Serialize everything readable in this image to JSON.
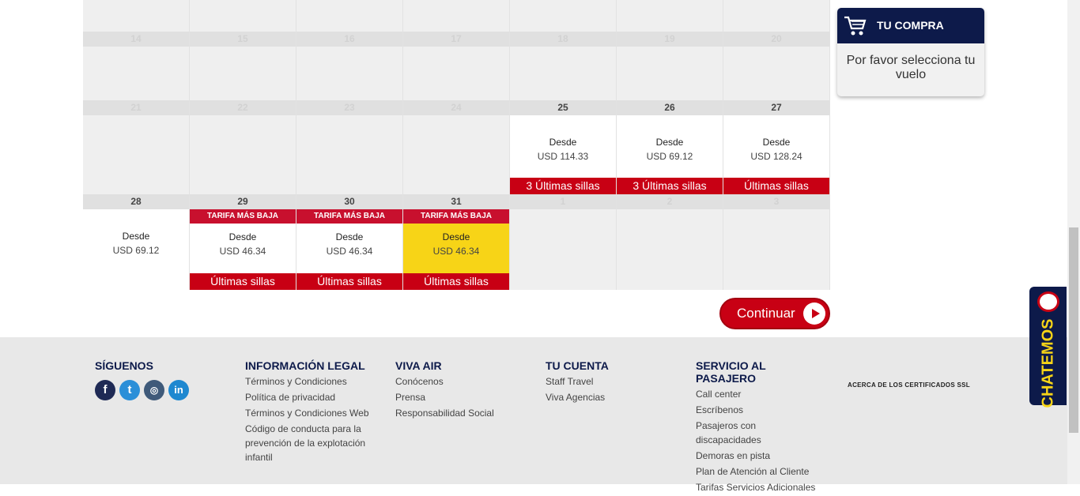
{
  "calendar": {
    "row1": [
      {},
      {},
      {},
      {},
      {},
      {},
      {}
    ],
    "row2": [
      {
        "day": "14"
      },
      {
        "day": "15"
      },
      {
        "day": "16"
      },
      {
        "day": "17"
      },
      {
        "day": "18"
      },
      {
        "day": "19"
      },
      {
        "day": "20"
      }
    ],
    "row3": [
      {
        "day": "21"
      },
      {
        "day": "22"
      },
      {
        "day": "23"
      },
      {
        "day": "24"
      },
      {
        "day": "25",
        "from": "Desde",
        "price": "USD 114.33",
        "seats": "3 Últimas sillas"
      },
      {
        "day": "26",
        "from": "Desde",
        "price": "USD 69.12",
        "seats": "3 Últimas sillas"
      },
      {
        "day": "27",
        "from": "Desde",
        "price": "USD 128.24",
        "seats": "Últimas sillas"
      }
    ],
    "row4": [
      {
        "day": "28",
        "from": "Desde",
        "price": "USD 69.12"
      },
      {
        "day": "29",
        "tag": "TARIFA MÁS BAJA",
        "from": "Desde",
        "price": "USD 46.34",
        "seats": "Últimas sillas"
      },
      {
        "day": "30",
        "tag": "TARIFA MÁS BAJA",
        "from": "Desde",
        "price": "USD 46.34",
        "seats": "Últimas sillas"
      },
      {
        "day": "31",
        "tag": "TARIFA MÁS BAJA",
        "from": "Desde",
        "price": "USD 46.34",
        "seats": "Últimas sillas",
        "selected": true
      },
      {
        "day": "1"
      },
      {
        "day": "2"
      },
      {
        "day": "3"
      }
    ]
  },
  "cart": {
    "title": "TU COMPRA",
    "message": "Por favor selecciona tu vuelo",
    "icon": "cart-icon"
  },
  "continue_label": "Continuar",
  "footer": {
    "follow": {
      "title": "SÍGUENOS",
      "icons": [
        "facebook-icon",
        "twitter-icon",
        "instagram-icon",
        "linkedin-icon"
      ]
    },
    "legal": {
      "title": "INFORMACIÓN LEGAL",
      "links": [
        "Términos y Condiciones",
        "Política de privacidad",
        "Términos y Condiciones Web",
        "Código de conducta para la prevención de la explotación infantil"
      ]
    },
    "viva": {
      "title": "VIVA AIR",
      "links": [
        "Conócenos",
        "Prensa",
        "Responsabilidad Social"
      ]
    },
    "account": {
      "title": "TU CUENTA",
      "links": [
        "Staff Travel",
        "Viva Agencias"
      ]
    },
    "service": {
      "title": "SERVICIO AL PASAJERO",
      "links": [
        "Call center",
        "Escríbenos",
        "Pasajeros con discapacidades",
        "Demoras en pista",
        "Plan de Atención al Cliente",
        "Tarifas Servicios Adicionales"
      ]
    },
    "ssl": "ACERCA DE LOS CERTIFICADOS SSL"
  },
  "chat": {
    "label": "CHATEMOS"
  },
  "colors": {
    "navy": "#0d1a4a",
    "red": "#c80014",
    "yellow": "#f7d417"
  }
}
